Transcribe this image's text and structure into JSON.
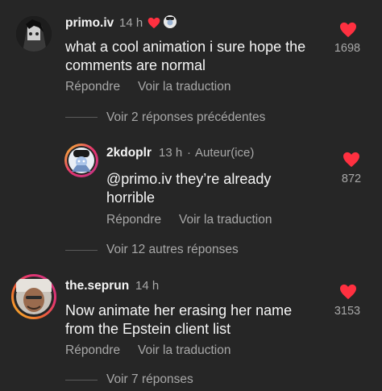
{
  "colors": {
    "background": "#262626",
    "heart": "#ff3040",
    "secondary_text": "#a8a8a8"
  },
  "comments": [
    {
      "username": "primo.iv",
      "time": "14 h",
      "text_lines": [
        "what a cool animation i sure hope the",
        "comments are normal"
      ],
      "likes": "1698",
      "reply_label": "Répondre",
      "translate_label": "Voir la traduction",
      "creator_liked": true,
      "view_replies_label": "Voir 2 réponses précédentes"
    },
    {
      "username": "2kdoplr",
      "time": "13 h",
      "author_badge": "Auteur(ice)",
      "text_lines": [
        "@primo.iv they’re already",
        "horrible"
      ],
      "likes": "872",
      "reply_label": "Répondre",
      "translate_label": "Voir la traduction",
      "view_replies_label": "Voir 12 autres réponses"
    },
    {
      "username": "the.seprun",
      "time": "14 h",
      "text_lines": [
        "Now animate her erasing her name",
        "from the Epstein client list"
      ],
      "likes": "3153",
      "reply_label": "Répondre",
      "translate_label": "Voir la traduction",
      "view_replies_label": "Voir 7 réponses"
    }
  ],
  "icons": {
    "like": "heart-icon",
    "creator_like": "creator-liked-heart-icon"
  }
}
